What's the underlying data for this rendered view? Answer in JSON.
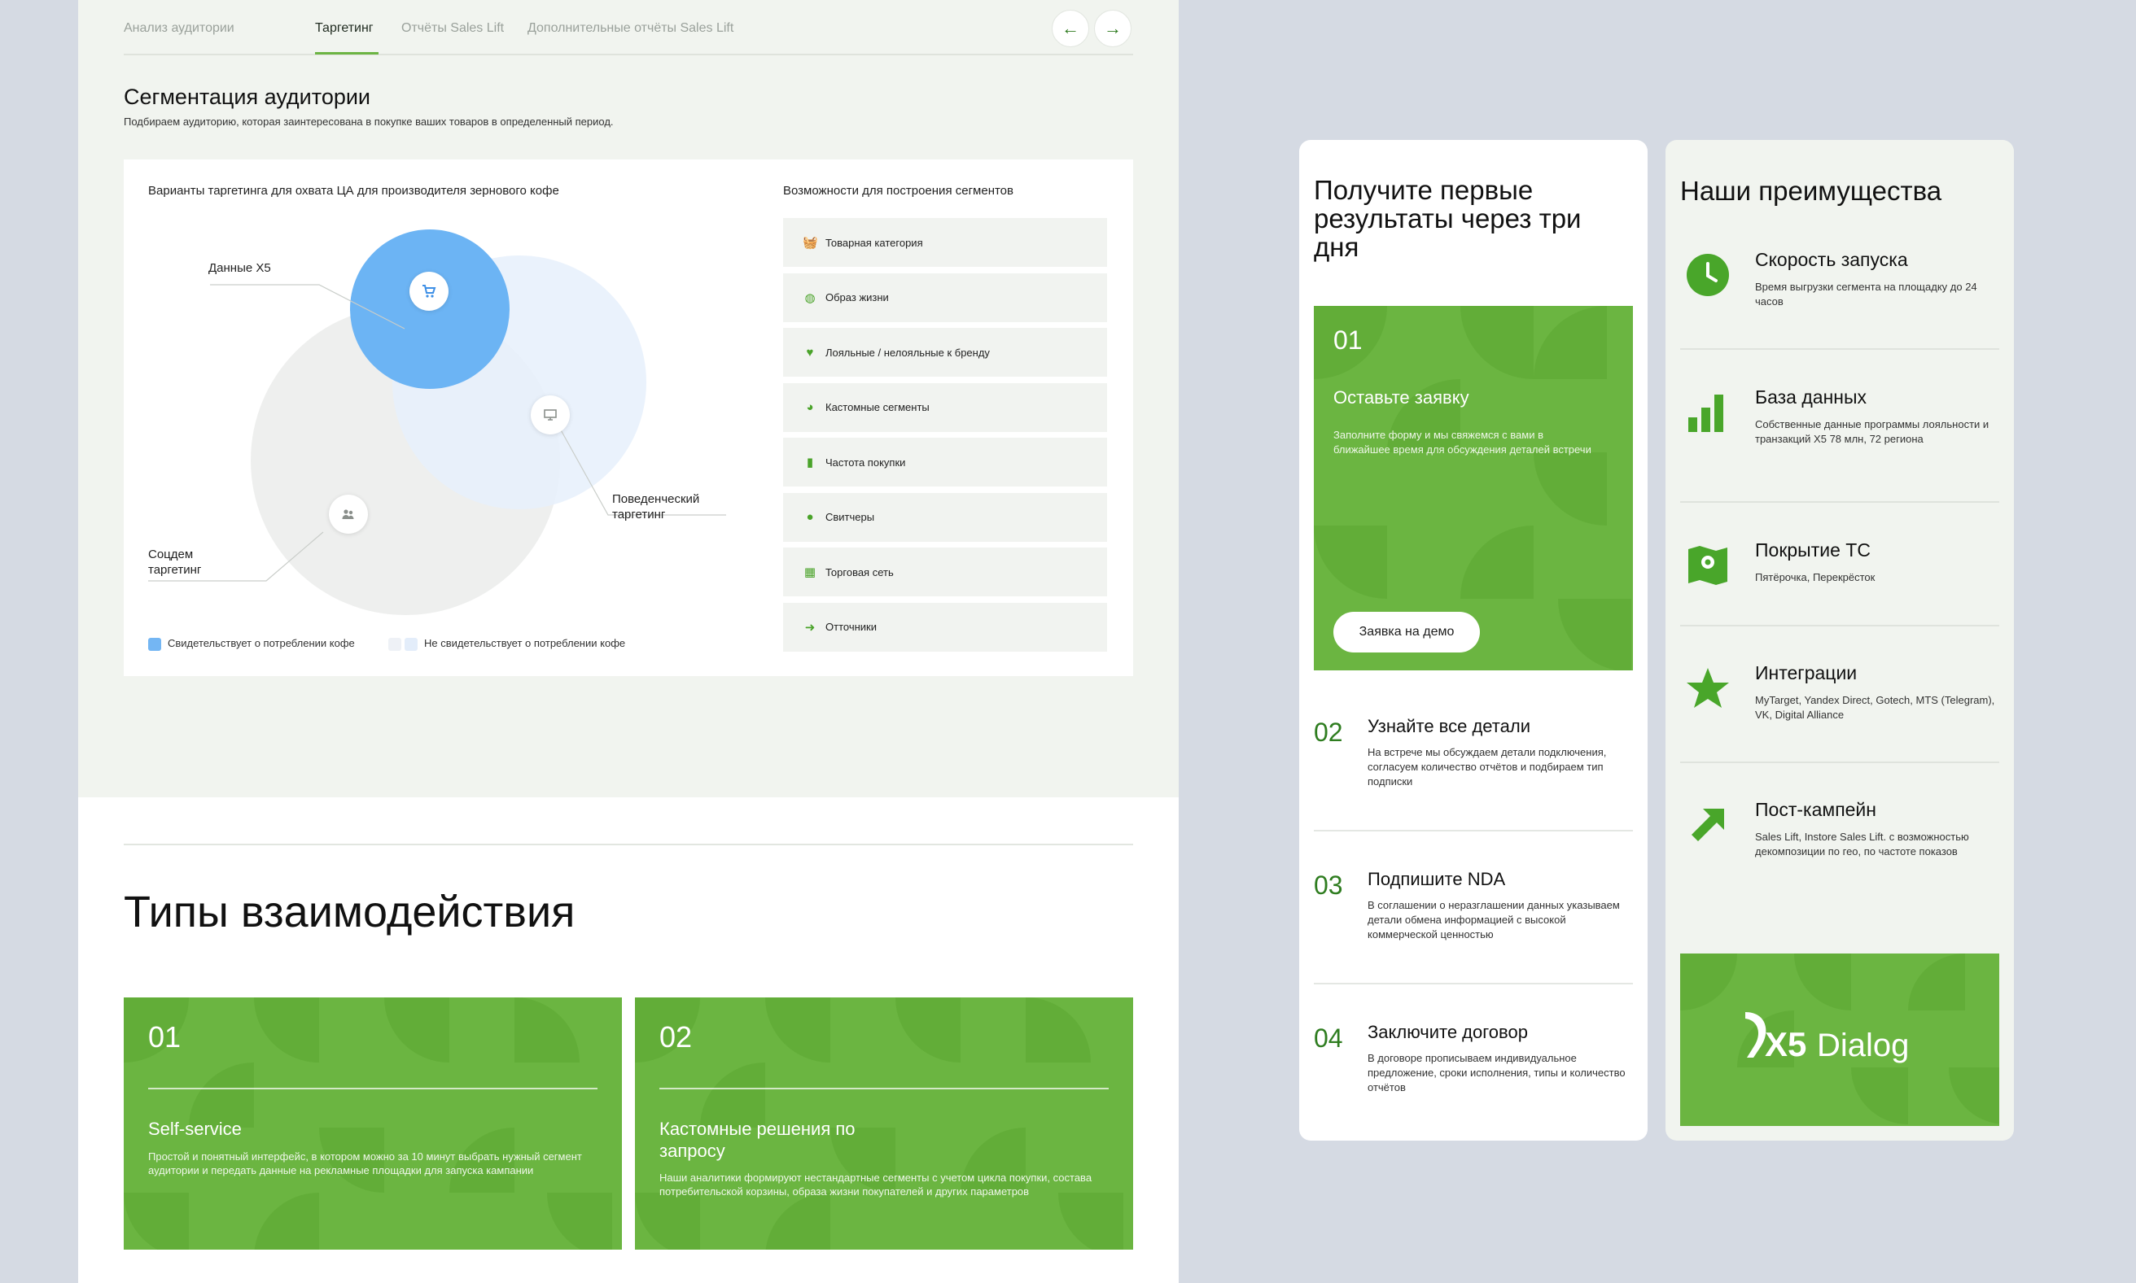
{
  "tabs": [
    {
      "label": "Анализ аудитории"
    },
    {
      "label": "Таргетинг"
    },
    {
      "label": "Отчёты Sales Lift"
    },
    {
      "label": "Дополнительные отчёты Sales Lift"
    }
  ],
  "active_tab": "Таргетинг",
  "nav": {
    "prev_icon": "←",
    "next_icon": "→"
  },
  "segmentation": {
    "title": "Сегментация аудитории",
    "subtitle": "Подбираем аудиторию, которая заинтересована в покупке ваших товаров в определенный период.",
    "chart_heading": "Варианты таргетинга для охвата ЦА для производителя зернового кофе",
    "venn_labels": {
      "x5": "Данные X5",
      "behavioral": "Поведенческий таргетинг",
      "socdem": "Соцдем таргетинг"
    },
    "legend": {
      "consumes": "Свидетельствует о потреблении кофе",
      "not_consumes": "Не свидетельствует о потреблении кофе"
    },
    "colors": {
      "consumes": "#74b6f3",
      "not_consumes": "#e9f1fb",
      "socdem": "#eeefee"
    },
    "segments_heading": "Возможности для построения сегментов",
    "segments": [
      {
        "label": "Товарная категория",
        "icon": "basket-icon"
      },
      {
        "label": "Образ жизни",
        "icon": "globe-icon"
      },
      {
        "label": "Лояльные / нелояльные к бренду",
        "icon": "heart-icon"
      },
      {
        "label": "Кастомные сегменты",
        "icon": "pie-icon"
      },
      {
        "label": "Частота покупки",
        "icon": "bars-icon"
      },
      {
        "label": "Свитчеры",
        "icon": "person-icon"
      },
      {
        "label": "Торговая сеть",
        "icon": "store-icon"
      },
      {
        "label": "Отточники",
        "icon": "arrow-right-icon"
      }
    ]
  },
  "interaction": {
    "title": "Типы взаимодействия",
    "cards": [
      {
        "num": "01",
        "title": "Self-service",
        "desc": "Простой и понятный интерфейс, в котором можно за 10 минут выбрать нужный сегмент аудитории и передать данные на рекламные площадки для запуска кампании"
      },
      {
        "num": "02",
        "title": "Кастомные решения по запросу",
        "desc": "Наши аналитики формируют нестандартные сегменты с учетом цикла покупки, состава потребительской корзины, образа жизни покупателей и других параметров"
      }
    ]
  },
  "steps": {
    "title": "Получите первые результаты через три дня",
    "items": [
      {
        "num": "01",
        "title": "Оставьте заявку",
        "desc": "Заполните форму и мы свяжемся с вами в ближайшее время для обсуждения деталей встречи",
        "button": "Заявка на демо"
      },
      {
        "num": "02",
        "title": "Узнайте все детали",
        "desc": "На встрече мы обсуждаем детали подключения, согласуем количество отчётов и подбираем тип подписки"
      },
      {
        "num": "03",
        "title": "Подпишите NDA",
        "desc": "В соглашении о неразглашении данных указываем детали обмена информацией с высокой коммерческой ценностью"
      },
      {
        "num": "04",
        "title": "Заключите договор",
        "desc": "В договоре прописываем индивидуальное предложение, сроки исполнения, типы и количество отчётов"
      }
    ]
  },
  "advantages": {
    "title": "Наши преимущества",
    "items": [
      {
        "title": "Скорость запуска",
        "desc": "Время выгрузки сегмента на площадку до 24 часов",
        "icon": "clock-icon"
      },
      {
        "title": "База данных",
        "desc": "Собственные данные программы лояльности и транзакций X5 78 млн, 72 региона",
        "icon": "bar-chart-icon"
      },
      {
        "title": "Покрытие ТС",
        "desc": "Пятёрочка, Перекрёсток",
        "icon": "map-pin-icon"
      },
      {
        "title": "Интеграции",
        "desc": "MyTarget, Yandex Direct, Gotech, MTS (Telegram), VK, Digital Alliance",
        "icon": "star-icon"
      },
      {
        "title": "Пост-кампейн",
        "desc": "Sales Lift, Instore Sales Lift. с возможностью декомпозиции по гео, по частоте показов",
        "icon": "arrow-up-right-icon"
      }
    ],
    "logo": "X5 Dialog"
  },
  "colors": {
    "accent": "#6bb541",
    "accent_dark": "#2f7d20",
    "blue": "#74b6f3"
  }
}
